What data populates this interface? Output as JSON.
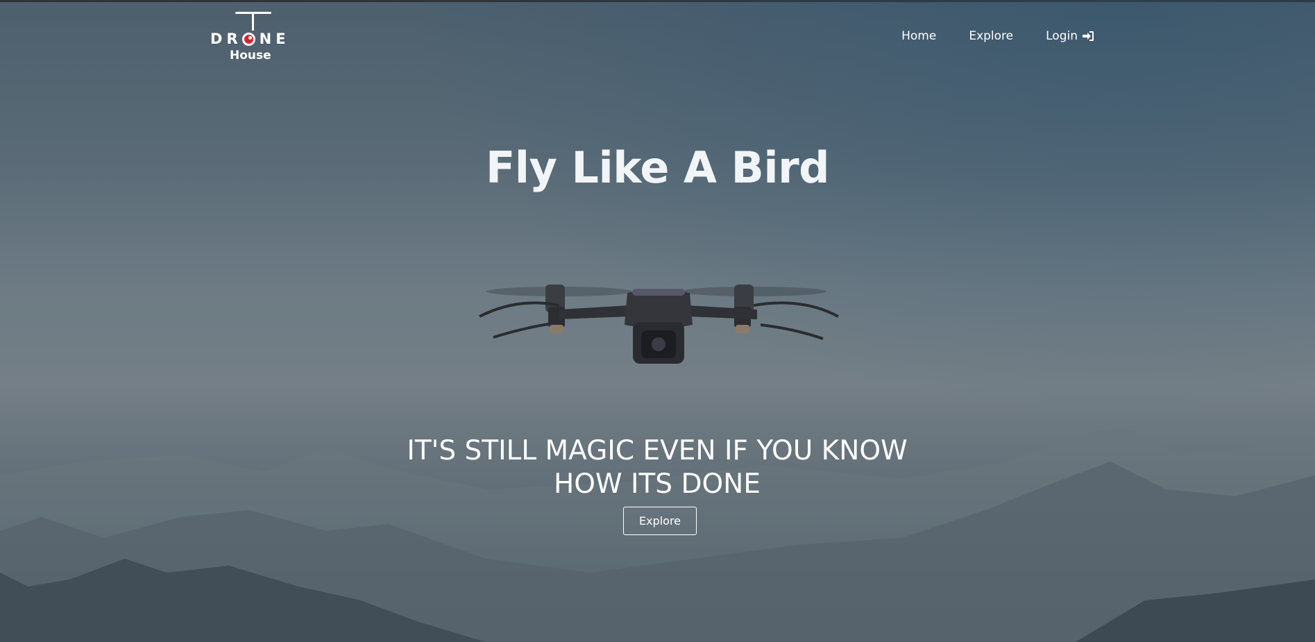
{
  "header": {
    "logo": {
      "word": "DRONE",
      "sub": "House"
    },
    "nav": [
      {
        "label": "Home"
      },
      {
        "label": "Explore"
      },
      {
        "label": "Login",
        "icon": "sign-in-icon"
      }
    ]
  },
  "hero": {
    "title": "Fly Like A Bird",
    "tagline": "IT'S STILL MAGIC EVEN IF YOU KNOW HOW ITS DONE",
    "button_label": "Explore",
    "image": "drone-image"
  },
  "colors": {
    "logo_accent": "#e0222d",
    "text": "#ffffff",
    "title": "#f2f5f8"
  }
}
